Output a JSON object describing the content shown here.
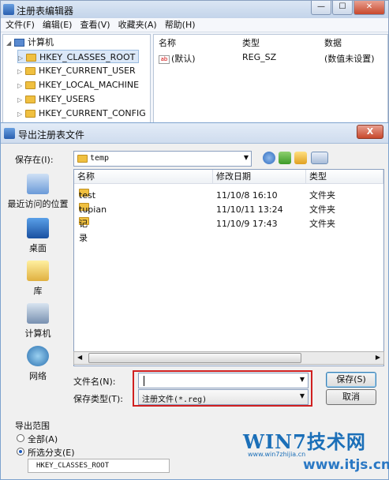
{
  "regedit": {
    "title": "注册表编辑器",
    "menu": [
      "文件(F)",
      "编辑(E)",
      "查看(V)",
      "收藏夹(A)",
      "帮助(H)"
    ],
    "tree_root": "计算机",
    "tree_items": [
      "HKEY_CLASSES_ROOT",
      "HKEY_CURRENT_USER",
      "HKEY_LOCAL_MACHINE",
      "HKEY_USERS",
      "HKEY_CURRENT_CONFIG"
    ],
    "list_headers": {
      "name": "名称",
      "type": "类型",
      "data": "数据"
    },
    "list_row": {
      "name": "(默认)",
      "type": "REG_SZ",
      "data": "(数值未设置)"
    }
  },
  "dialog": {
    "title": "导出注册表文件",
    "close_label": "X",
    "save_in_label": "保存在(I):",
    "save_in_value": "temp",
    "places": [
      "最近访问的位置",
      "桌面",
      "库",
      "计算机",
      "网络"
    ],
    "columns": {
      "name": "名称",
      "modified": "修改日期",
      "type": "类型"
    },
    "files": [
      {
        "name": "test",
        "modified": "11/10/8 16:10",
        "type": "文件夹"
      },
      {
        "name": "tupian",
        "modified": "11/10/11 13:24",
        "type": "文件夹"
      },
      {
        "name": "记录",
        "modified": "11/10/9 17:43",
        "type": "文件夹"
      }
    ],
    "filename_label": "文件名(N):",
    "filename_value": "",
    "filetype_label": "保存类型(T):",
    "filetype_value": "注册文件(*.reg)",
    "save_button": "保存(S)",
    "cancel_button": "取消",
    "export_range_label": "导出范围",
    "radio_all": "全部(A)",
    "radio_branch": "所选分支(E)",
    "branch_value": "HKEY_CLASSES_ROOT"
  },
  "watermark": {
    "brand": "WIN7技术网",
    "url_small": "www.win7zhijia.cn",
    "url_big": "www.itjs.cn"
  },
  "colors": {
    "highlight": "#d02020",
    "accent": "#1b6fb8",
    "folder": "#f0c040"
  }
}
